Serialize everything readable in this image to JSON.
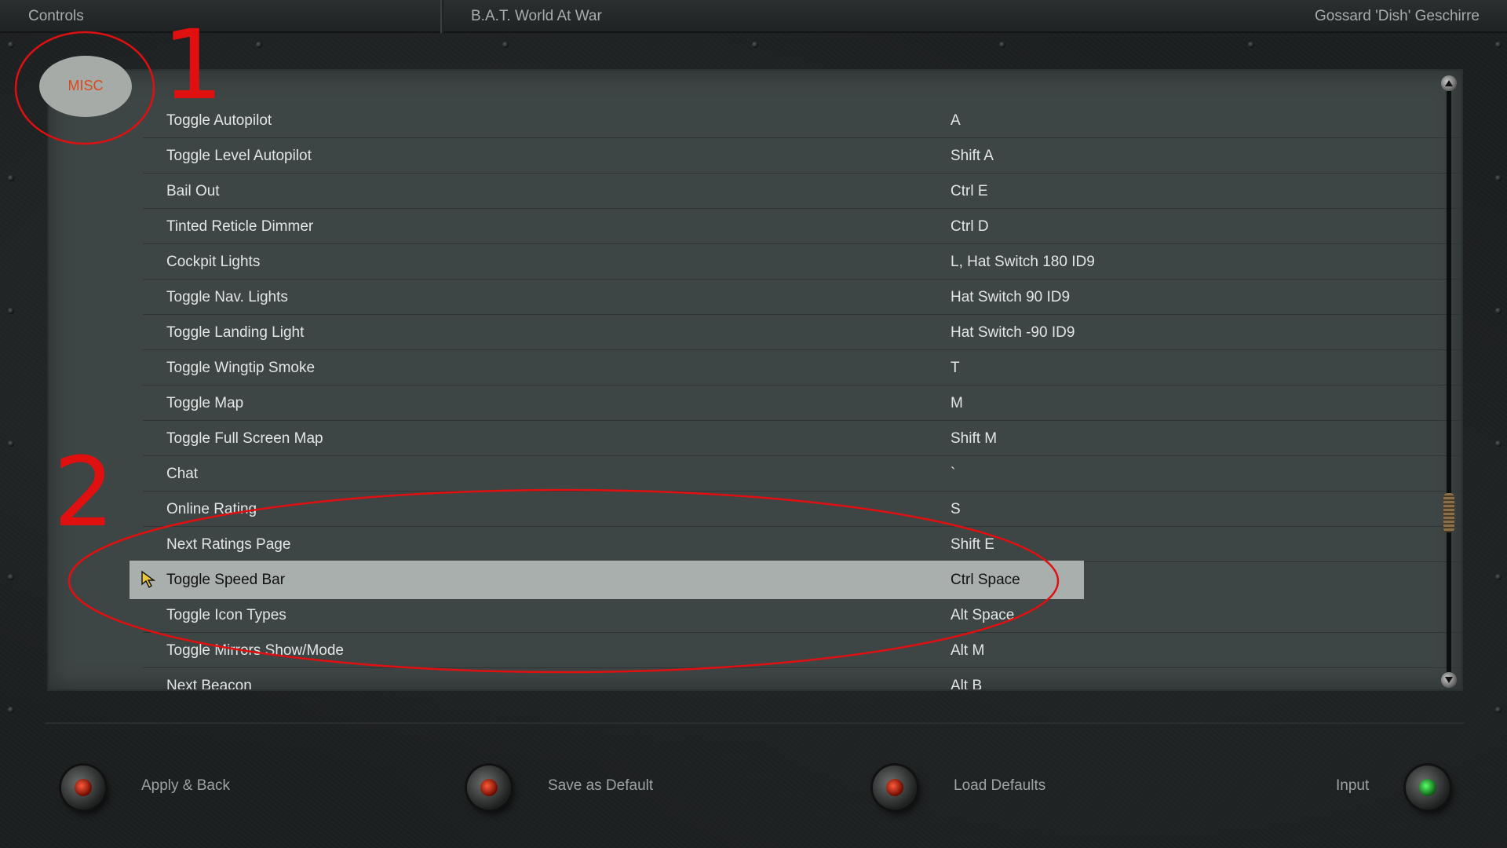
{
  "header": {
    "section": "Controls",
    "game_title": "B.A.T. World At War",
    "user": "Gossard 'Dish' Geschirre"
  },
  "category": "MISC",
  "bindings": [
    {
      "action": "Toggle Autopilot",
      "key": "A"
    },
    {
      "action": "Toggle Level Autopilot",
      "key": "Shift A"
    },
    {
      "action": "Bail Out",
      "key": "Ctrl E"
    },
    {
      "action": "Tinted Reticle Dimmer",
      "key": "Ctrl D"
    },
    {
      "action": "Cockpit Lights",
      "key": "L, Hat Switch 180 ID9"
    },
    {
      "action": "Toggle Nav. Lights",
      "key": "Hat Switch 90 ID9"
    },
    {
      "action": "Toggle Landing Light",
      "key": "Hat Switch -90 ID9"
    },
    {
      "action": "Toggle Wingtip Smoke",
      "key": "T"
    },
    {
      "action": "Toggle Map",
      "key": "M"
    },
    {
      "action": "Toggle Full Screen Map",
      "key": "Shift M"
    },
    {
      "action": "Chat",
      "key": "`"
    },
    {
      "action": "Online Rating",
      "key": "S"
    },
    {
      "action": "Next Ratings Page",
      "key": "Shift E"
    },
    {
      "action": "Toggle Speed Bar",
      "key": "Ctrl Space"
    },
    {
      "action": "Toggle Icon Types",
      "key": "Alt Space"
    },
    {
      "action": "Toggle Mirrors Show/Mode",
      "key": "Alt M"
    },
    {
      "action": "Next Beacon",
      "key": "Alt B"
    }
  ],
  "selected_index": 13,
  "scroll_position": 0.74,
  "annotations": {
    "one": "1",
    "two": "2"
  },
  "footer": {
    "apply_back": "Apply & Back",
    "save_default": "Save as Default",
    "load_defaults": "Load Defaults",
    "input": "Input"
  },
  "colors": {
    "category_text": "#d84a1c",
    "annotation": "#e01010",
    "selected_row": "#a9afac",
    "lamp_red": "#ff5a3a",
    "lamp_green": "#5aff6a"
  }
}
